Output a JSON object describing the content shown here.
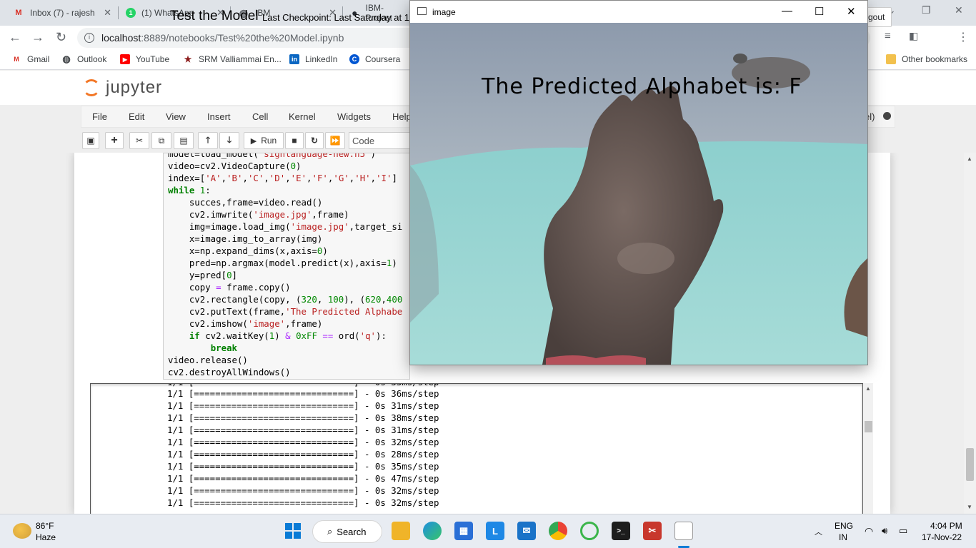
{
  "browser": {
    "tabs": [
      {
        "label": "Inbox (7) - rajesh",
        "icon": "gmail-icon",
        "color": "#d93025",
        "glyph": "M"
      },
      {
        "label": "(1) WhatsApp",
        "icon": "whatsapp-icon",
        "color": "#25d366",
        "glyph": "1"
      },
      {
        "label": "IBM",
        "icon": "globe-icon",
        "color": "#5f6368",
        "glyph": "◍"
      },
      {
        "label": "IBM-Project",
        "icon": "github-icon",
        "color": "#24292f",
        "glyph": "●"
      }
    ],
    "url_host": "localhost",
    "url_path": ":8889/notebooks/Test%20the%20Model.ipynb",
    "bookmarks": [
      {
        "label": "Gmail",
        "icon": "gmail-icon",
        "color": "#d93025",
        "glyph": "M"
      },
      {
        "label": "Outlook",
        "icon": "globe-icon",
        "color": "#3c4043",
        "glyph": "◍"
      },
      {
        "label": "YouTube",
        "icon": "youtube-icon",
        "color": "#ff0000",
        "glyph": "▶"
      },
      {
        "label": "SRM Valliammai En...",
        "icon": "srm-icon",
        "color": "#8b1a1a",
        "glyph": "★"
      },
      {
        "label": "LinkedIn",
        "icon": "linkedin-icon",
        "color": "#0a66c2",
        "glyph": "in"
      },
      {
        "label": "Coursera",
        "icon": "coursera-icon",
        "color": "#0056d2",
        "glyph": "C"
      }
    ],
    "other_bookmarks": "Other bookmarks"
  },
  "jupyter": {
    "logo_text": "jupyter",
    "notebook_title": "Test the Model",
    "checkpoint": "Last Checkpoint: Last Saturday at 1",
    "logout": "gout",
    "menu": [
      "File",
      "Edit",
      "View",
      "Insert",
      "Cell",
      "Kernel",
      "Widgets",
      "Help"
    ],
    "kernel_indicator": "el)",
    "run_label": "Run",
    "cell_type": "Code"
  },
  "cv_window": {
    "title": "image",
    "prediction_text": "The Predicted Alphabet is: F"
  },
  "output_lines": [
    "1/1 [==============================] - 0s 36ms/step",
    "1/1 [==============================] - 0s 31ms/step",
    "1/1 [==============================] - 0s 38ms/step",
    "1/1 [==============================] - 0s 31ms/step",
    "1/1 [==============================] - 0s 32ms/step",
    "1/1 [==============================] - 0s 28ms/step",
    "1/1 [==============================] - 0s 35ms/step",
    "1/1 [==============================] - 0s 47ms/step",
    "1/1 [==============================] - 0s 32ms/step",
    "1/1 [==============================] - 0s 32ms/step"
  ],
  "taskbar": {
    "weather_temp": "86°F",
    "weather_desc": "Haze",
    "search_label": "Search",
    "lang_top": "ENG",
    "lang_bottom": "IN",
    "time": "4:04 PM",
    "date": "17-Nov-22"
  }
}
